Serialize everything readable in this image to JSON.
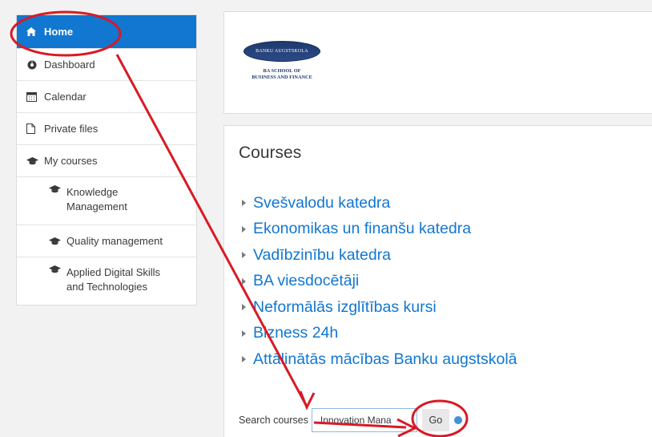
{
  "nav": {
    "items": [
      {
        "label": "Home",
        "icon": "home-icon"
      },
      {
        "label": "Dashboard",
        "icon": "dashboard-icon"
      },
      {
        "label": "Calendar",
        "icon": "calendar-icon"
      },
      {
        "label": "Private files",
        "icon": "file-icon"
      },
      {
        "label": "My courses",
        "icon": "graduation-cap-icon"
      },
      {
        "label": "Knowledge Management",
        "icon": "graduation-cap-icon"
      },
      {
        "label": "Quality management",
        "icon": "graduation-cap-icon"
      },
      {
        "label": "Applied Digital Skills and Technologies",
        "icon": "graduation-cap-icon"
      }
    ]
  },
  "logo": {
    "pill_text": "BANKU AUGSTSKOLA",
    "line1": "BA SCHOOL OF",
    "line2": "BUSINESS AND FINANCE"
  },
  "courses": {
    "title": "Courses",
    "items": [
      "Svešvalodu katedra",
      "Ekonomikas un finanšu katedra",
      "Vadībzinību katedra",
      "BA viesdocētāji",
      "Neformālās izglītības kursi",
      "Bizness 24h",
      "Attālinātās mācības Banku augstskolā"
    ]
  },
  "search": {
    "label": "Search courses",
    "value": "Innovation Mana",
    "button": "Go"
  },
  "colors": {
    "accent": "#1177d1",
    "annotation": "#d81a25"
  }
}
